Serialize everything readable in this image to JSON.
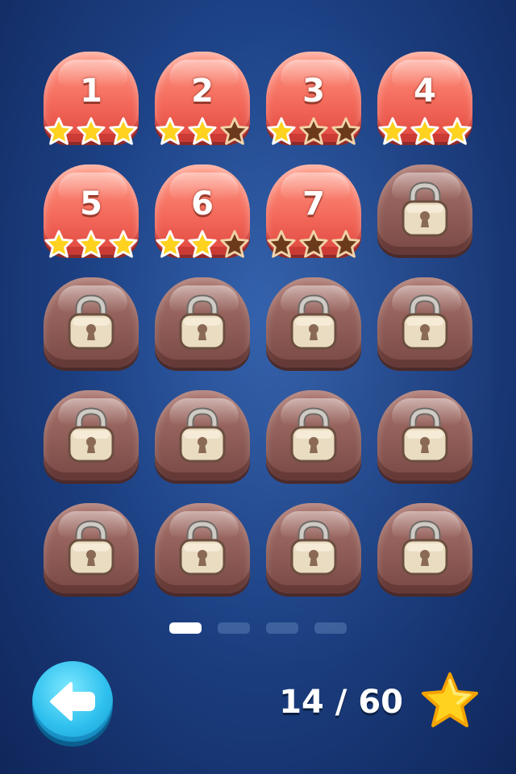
{
  "levels": [
    {
      "label": "1",
      "state": "unlocked",
      "stars": 3
    },
    {
      "label": "2",
      "state": "unlocked",
      "stars": 2
    },
    {
      "label": "3",
      "state": "unlocked",
      "stars": 1
    },
    {
      "label": "4",
      "state": "unlocked",
      "stars": 3
    },
    {
      "label": "5",
      "state": "unlocked",
      "stars": 3
    },
    {
      "label": "6",
      "state": "unlocked",
      "stars": 2
    },
    {
      "label": "7",
      "state": "unlocked",
      "stars": 0
    },
    {
      "label": "",
      "state": "locked",
      "stars": 0
    },
    {
      "label": "",
      "state": "locked",
      "stars": 0
    },
    {
      "label": "",
      "state": "locked",
      "stars": 0
    },
    {
      "label": "",
      "state": "locked",
      "stars": 0
    },
    {
      "label": "",
      "state": "locked",
      "stars": 0
    },
    {
      "label": "",
      "state": "locked",
      "stars": 0
    },
    {
      "label": "",
      "state": "locked",
      "stars": 0
    },
    {
      "label": "",
      "state": "locked",
      "stars": 0
    },
    {
      "label": "",
      "state": "locked",
      "stars": 0
    },
    {
      "label": "",
      "state": "locked",
      "stars": 0
    },
    {
      "label": "",
      "state": "locked",
      "stars": 0
    },
    {
      "label": "",
      "state": "locked",
      "stars": 0
    },
    {
      "label": "",
      "state": "locked",
      "stars": 0
    }
  ],
  "pager": {
    "pages": 4,
    "current": 1
  },
  "footer": {
    "score": "14 / 60",
    "back_icon": "back-arrow-icon",
    "star_icon": "star-icon"
  },
  "colors": {
    "star_filled": "#ffd21f",
    "star_empty": "#6b3a1c",
    "accent": "#2fc0ee"
  }
}
